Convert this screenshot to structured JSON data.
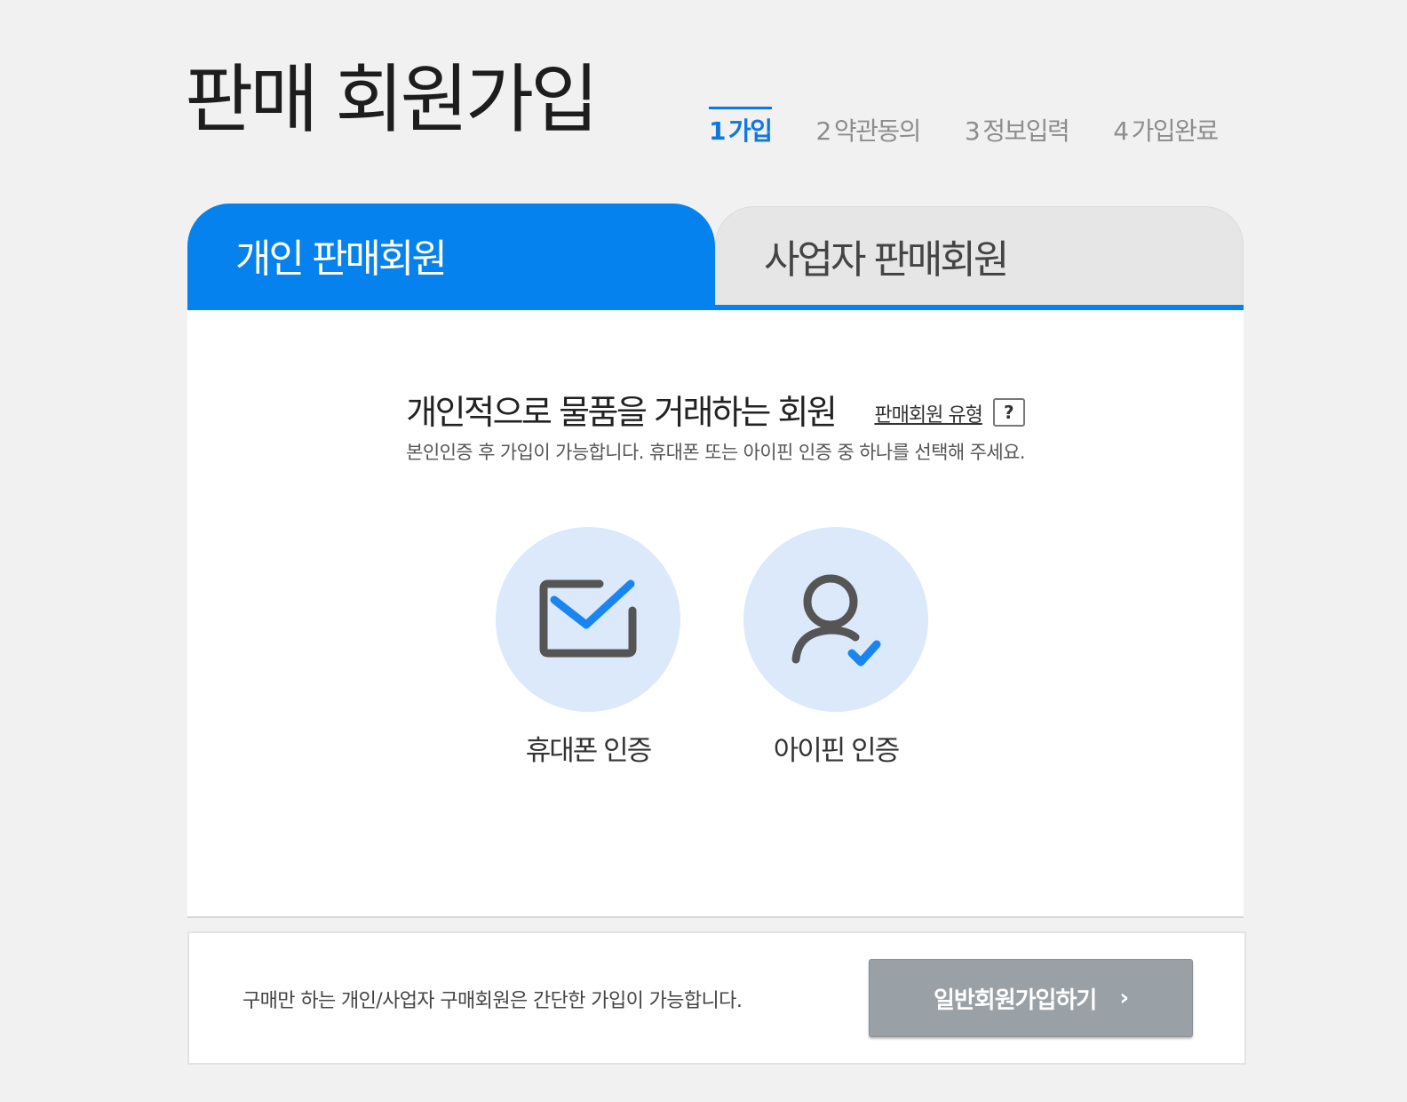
{
  "page": {
    "title": "판매 회원가입"
  },
  "steps": [
    {
      "num": "1",
      "label": "가입"
    },
    {
      "num": "2",
      "label": "약관동의"
    },
    {
      "num": "3",
      "label": "정보입력"
    },
    {
      "num": "4",
      "label": "가입완료"
    }
  ],
  "active_step": 1,
  "tabs": {
    "personal": "개인 판매회원",
    "business": "사업자 판매회원"
  },
  "panel": {
    "headline": "개인적으로 물품을 거래하는 회원",
    "type_link": "판매회원 유형",
    "help_label": "?",
    "subtext": "본인인증 후 가입이 가능합니다. 휴대폰 또는 아이핀 인증 중 하나를 선택해 주세요."
  },
  "auth_options": [
    {
      "label": "휴대폰 인증",
      "icon": "envelope-check-icon"
    },
    {
      "label": "아이핀 인증",
      "icon": "user-check-icon"
    }
  ],
  "footer": {
    "text": "구매만 하는 개인/사업자 구매회원은 간단한 가입이 가능합니다.",
    "button_label": "일반회원가입하기",
    "chevron": "›"
  },
  "colors": {
    "accent": "#0582ee",
    "circle_bg": "#dbe9fb",
    "button_bg": "#99a0a6"
  }
}
